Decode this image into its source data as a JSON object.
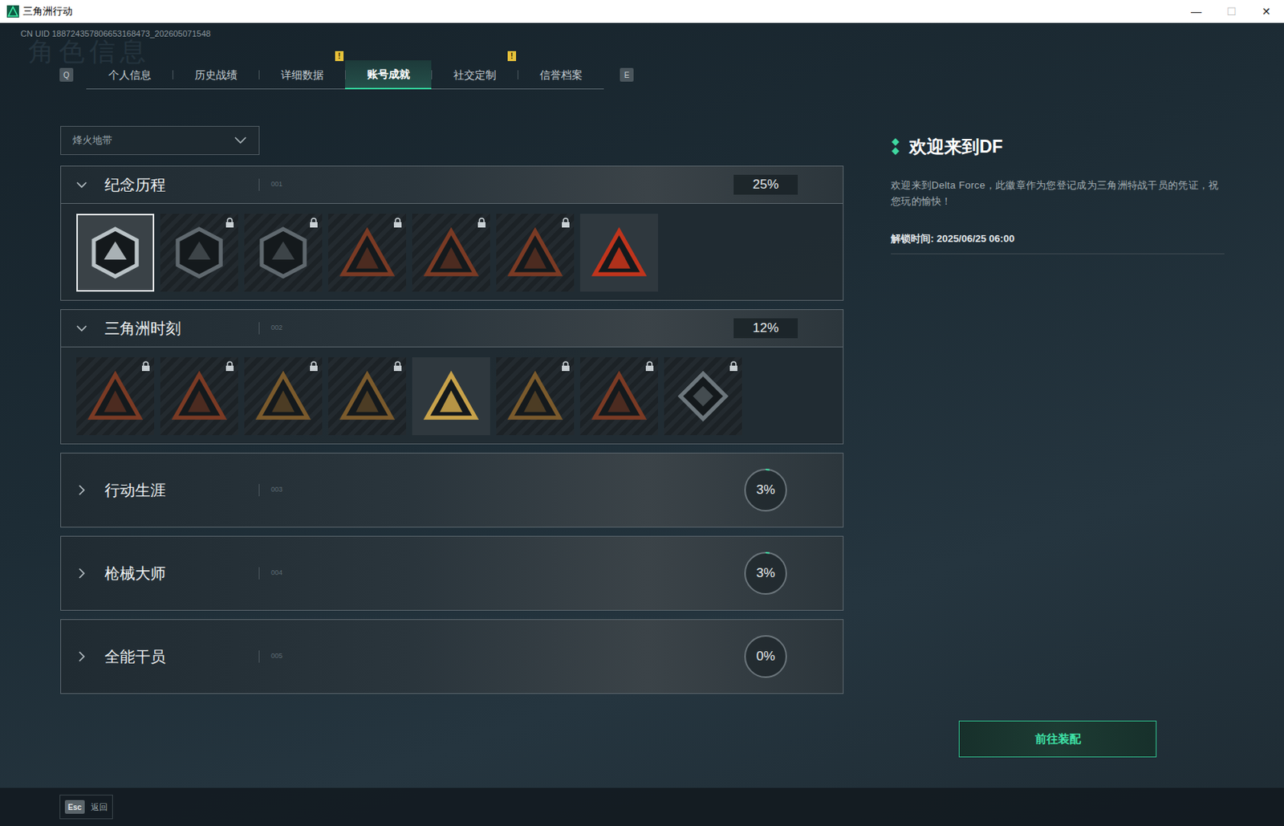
{
  "window": {
    "title": "三角洲行动",
    "controls": [
      "—",
      "☐",
      "✕"
    ]
  },
  "page_watermark": "角色信息",
  "uid": "CN UID 188724357806653168473_202605071548",
  "tabs": {
    "prev_key": "Q",
    "next_key": "E",
    "alert_glyph": "!",
    "items": [
      {
        "label": "个人信息",
        "selected": false,
        "alert": false
      },
      {
        "label": "历史战绩",
        "selected": false,
        "alert": false
      },
      {
        "label": "详细数据",
        "selected": false,
        "alert": true
      },
      {
        "label": "账号成就",
        "selected": true,
        "alert": false
      },
      {
        "label": "社交定制",
        "selected": false,
        "alert": true
      },
      {
        "label": "信誉档案",
        "selected": false,
        "alert": false
      }
    ]
  },
  "mode_select": {
    "value": "烽火地带"
  },
  "sections": [
    {
      "title": "纪念历程",
      "code": "001",
      "percent": "25%",
      "expanded": true,
      "badges": [
        {
          "kind": "hexagon",
          "color": "#b9c2c6",
          "locked": false,
          "selected": true
        },
        {
          "kind": "hexagon",
          "color": "#5f686e",
          "locked": true,
          "selected": false
        },
        {
          "kind": "hexagon",
          "color": "#5f686e",
          "locked": true,
          "selected": false
        },
        {
          "kind": "triangle",
          "color": "#7a3a24",
          "locked": true,
          "selected": false
        },
        {
          "kind": "triangle",
          "color": "#7a3a24",
          "locked": true,
          "selected": false
        },
        {
          "kind": "triangle",
          "color": "#7a3a24",
          "locked": true,
          "selected": false
        },
        {
          "kind": "triangle",
          "color": "#c0341c",
          "locked": false,
          "selected": false
        }
      ]
    },
    {
      "title": "三角洲时刻",
      "code": "002",
      "percent": "12%",
      "expanded": true,
      "badges": [
        {
          "kind": "triangle",
          "color": "#7a3a24",
          "locked": true,
          "selected": false
        },
        {
          "kind": "triangle",
          "color": "#7a3a24",
          "locked": true,
          "selected": false
        },
        {
          "kind": "triangle",
          "color": "#7a5a2c",
          "locked": true,
          "selected": false
        },
        {
          "kind": "triangle",
          "color": "#7a5a2c",
          "locked": true,
          "selected": false
        },
        {
          "kind": "triangle",
          "color": "#c8a24a",
          "locked": false,
          "selected": false
        },
        {
          "kind": "triangle",
          "color": "#7a5a2c",
          "locked": true,
          "selected": false
        },
        {
          "kind": "triangle",
          "color": "#7a3a24",
          "locked": true,
          "selected": false
        },
        {
          "kind": "diamond",
          "color": "#6c767c",
          "locked": true,
          "selected": false
        }
      ]
    },
    {
      "title": "行动生涯",
      "code": "003",
      "percent": "3%",
      "expanded": false,
      "level": 0.03
    },
    {
      "title": "枪械大师",
      "code": "004",
      "percent": "3%",
      "expanded": false,
      "level": 0.03
    },
    {
      "title": "全能干员",
      "code": "005",
      "percent": "0%",
      "expanded": false,
      "level": 0
    }
  ],
  "detail": {
    "title": "欢迎来到DF",
    "description": "欢迎来到Delta Force，此徽章作为您登记成为三角洲特战干员的凭证，祝您玩的愉快！",
    "unlock_time": "解锁时间: 2025/06/25 06:00"
  },
  "equip_button": "前往装配",
  "back": {
    "key": "Esc",
    "label": "返回"
  }
}
